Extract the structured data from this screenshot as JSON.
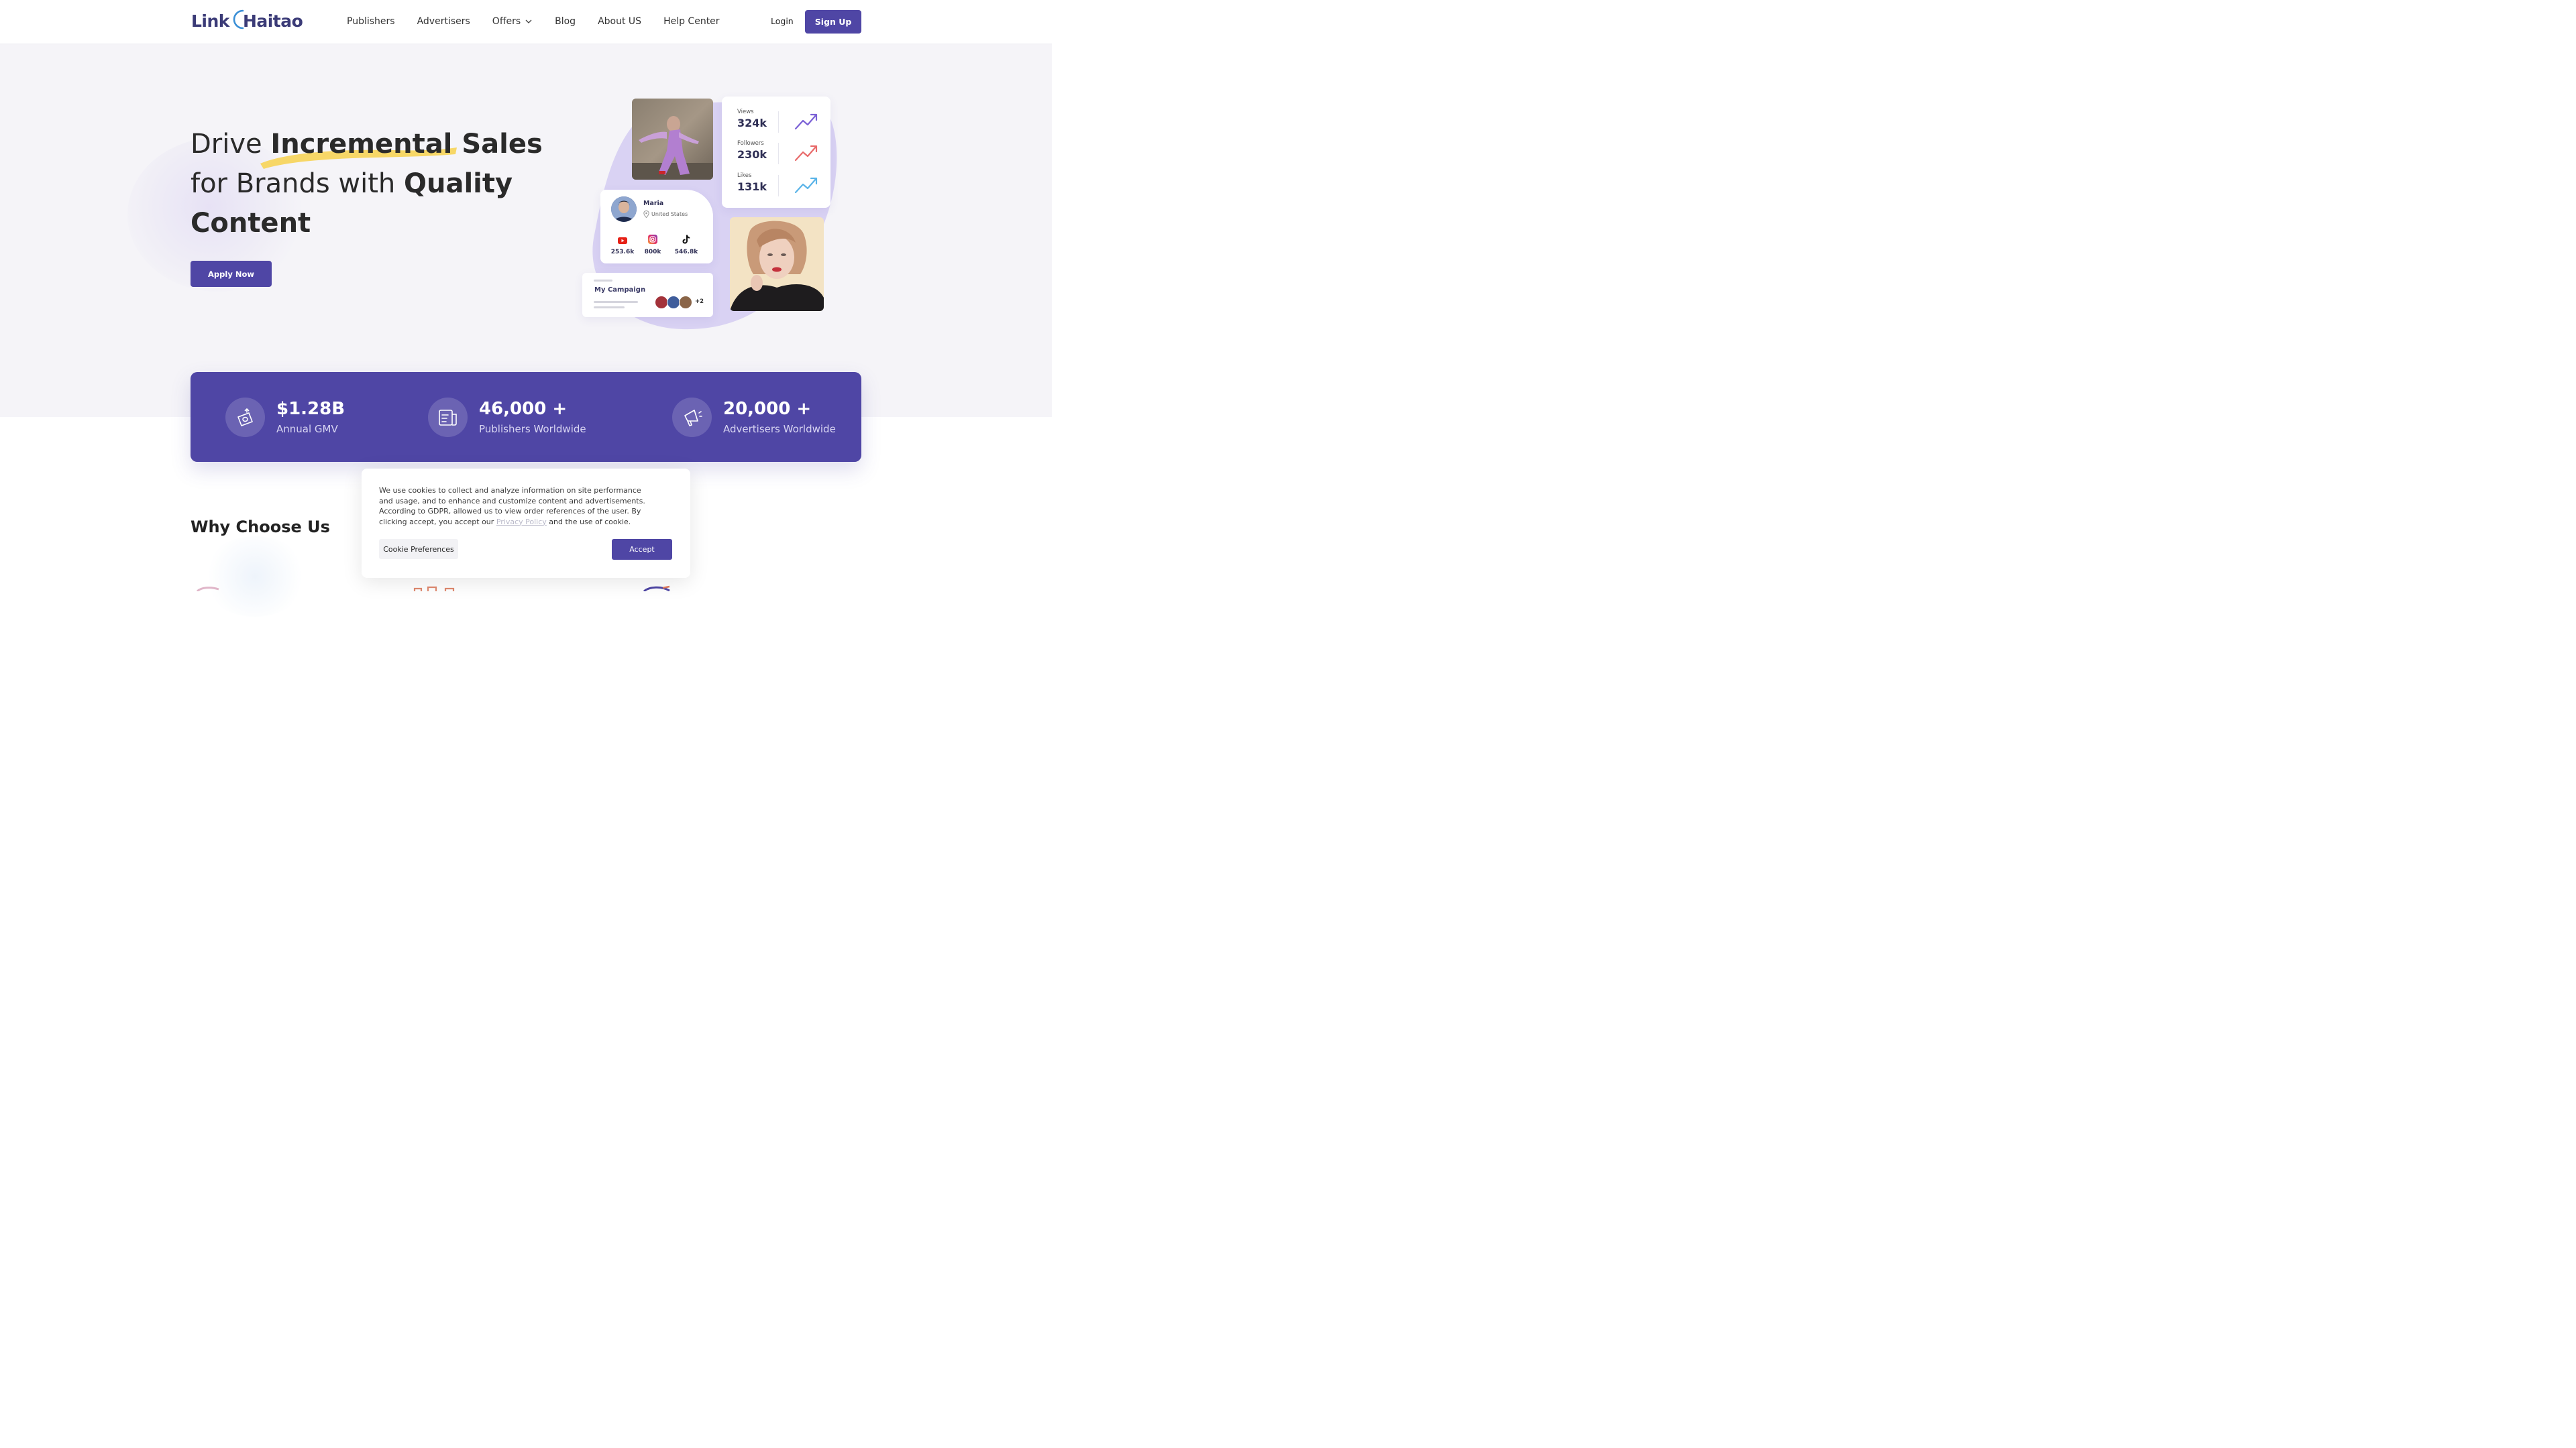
{
  "header": {
    "logo_left": "Link",
    "logo_right": "Haitao",
    "nav": [
      {
        "label": "Publishers"
      },
      {
        "label": "Advertisers"
      },
      {
        "label": "Offers"
      },
      {
        "label": "Blog"
      },
      {
        "label": "About US"
      },
      {
        "label": "Help Center"
      }
    ],
    "login": "Login",
    "signup": "Sign Up"
  },
  "hero": {
    "line1_a": "Drive ",
    "line1_b": "Incremental Sales",
    "line2_a": "for Brands with ",
    "line2_b": "Quality",
    "line3_b": "Content",
    "apply": "Apply Now"
  },
  "illustration": {
    "stats": [
      {
        "label": "Views",
        "value": "324k",
        "color": "#7b61d6"
      },
      {
        "label": "Followers",
        "value": "230k",
        "color": "#e86a6a"
      },
      {
        "label": "Likes",
        "value": "131k",
        "color": "#5ab4e8"
      }
    ],
    "profile": {
      "name": "Maria",
      "location": "United States",
      "youtube": "253.6k",
      "instagram": "800k",
      "tiktok": "546.8k"
    },
    "campaign": {
      "title": "My Campaign",
      "extra": "+2"
    }
  },
  "banner": [
    {
      "value": "$1.28B",
      "label": "Annual GMV",
      "icon": "money-icon"
    },
    {
      "value": "46,000 +",
      "label": "Publishers Worldwide",
      "icon": "publisher-icon"
    },
    {
      "value": "20,000 +",
      "label": "Advertisers Worldwide",
      "icon": "megaphone-icon"
    }
  ],
  "why": {
    "title": "Why Choose Us"
  },
  "cookie": {
    "text_before": "We use cookies to collect and analyze information on site performance and usage, and to enhance and customize content and advertisements. According to GDPR, allowed us to view order references of the user. By clicking accept, you accept our ",
    "link": "Privacy Policy",
    "text_after": " and the use of cookie.",
    "preferences": "Cookie Preferences",
    "accept": "Accept"
  },
  "colors": {
    "brand": "#4f46a5",
    "hero_bg": "#f5f4f8",
    "highlight": "#f7d456"
  }
}
